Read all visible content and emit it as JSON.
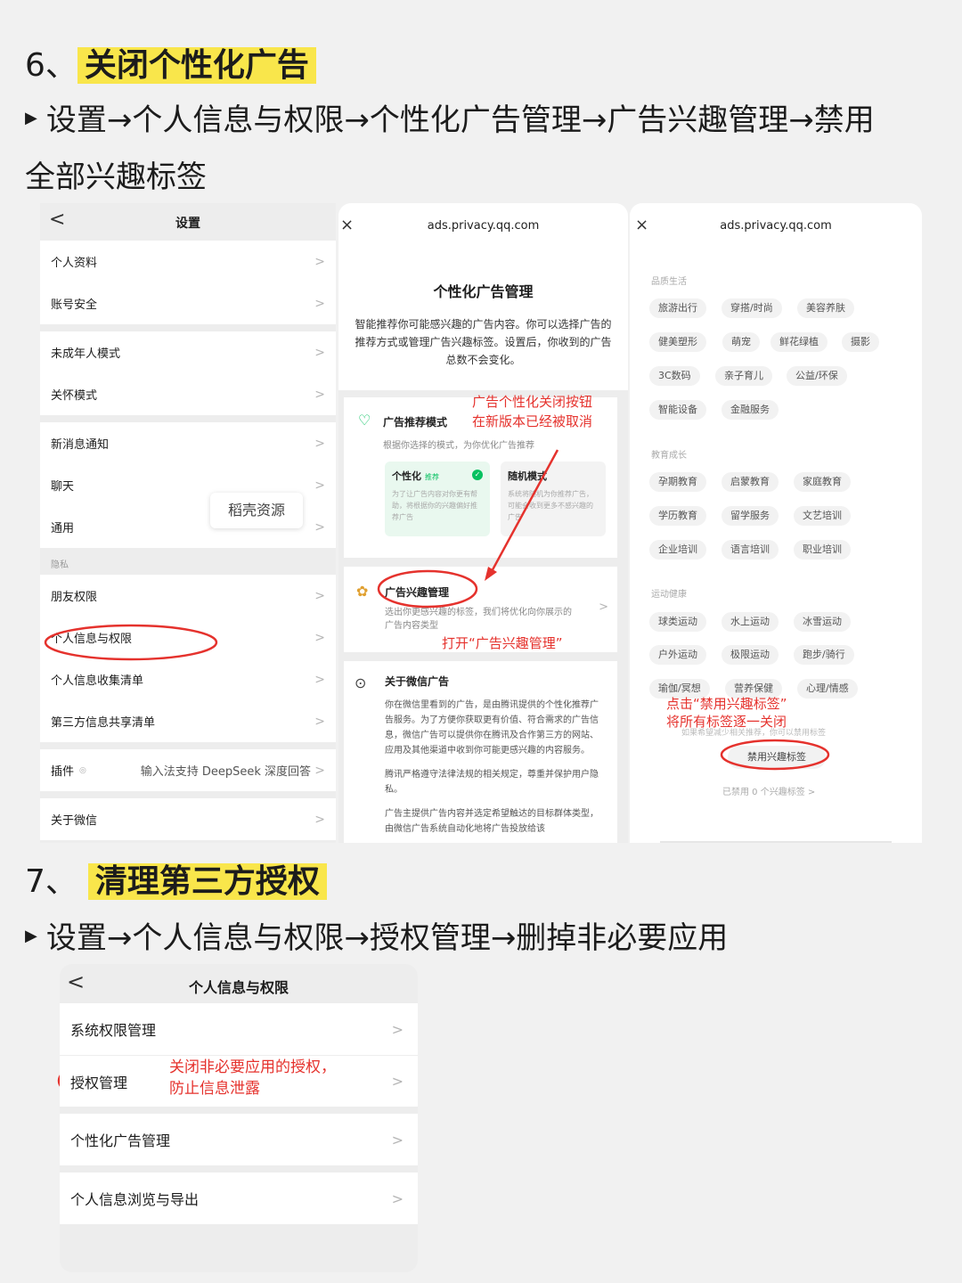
{
  "section6": {
    "num": "6、",
    "title": "关闭个性化广告",
    "path_line1": "设置→个人信息与权限→个性化广告管理→广告兴趣管理→禁用",
    "path_line2": "全部兴趣标签"
  },
  "panel_settings": {
    "back": "<",
    "title": "设置",
    "groups": [
      [
        "个人资料",
        "账号安全"
      ],
      [
        "未成年人模式",
        "关怀模式"
      ],
      [
        "新消息通知",
        "聊天",
        "通用"
      ]
    ],
    "privacy_header": "隐私",
    "privacy_items": [
      "朋友权限",
      "个人信息与权限",
      "个人信息收集清单",
      "第三方信息共享清单"
    ],
    "plugin_label": "插件",
    "plugin_value": "输入法支持 DeepSeek 深度回答",
    "about": "关于微信",
    "chevron": ">",
    "toast": "稻壳资源"
  },
  "panel_ads": {
    "close": "×",
    "url": "ads.privacy.qq.com",
    "heading": "个性化广告管理",
    "desc": "智能推荐你可能感兴趣的广告内容。你可以选择广告的推荐方式或管理广告兴趣标签。设置后，你收到的广告总数不会变化。",
    "rec_title": "广告推荐模式",
    "rec_sub": "根据你选择的模式，为你优化广告推荐",
    "mode_personal": "个性化",
    "mode_badge": "推荐",
    "mode_personal_desc": "为了让广告内容对你更有帮助，将根据你的兴趣偏好推荐广告",
    "mode_random": "随机模式",
    "mode_random_desc": "系统将随机为你推荐广告，可能会收到更多不感兴趣的广告",
    "interest_title": "广告兴趣管理",
    "interest_sub": "选出你更感兴趣的标签，我们将优化向你展示的广告内容类型",
    "about_title": "关于微信广告",
    "about_p1": "你在微信里看到的广告，是由腾讯提供的个性化推荐广告服务。为了方便你获取更有价值、符合需求的广告信息，微信广告可以提供你在腾讯及合作第三方的网站、应用及其他渠道中收到你可能更感兴趣的内容服务。",
    "about_p2": "腾讯严格遵守法律法规的相关规定，尊重并保护用户隐私。",
    "about_p3": "广告主提供广告内容并选定希望触达的目标群体类型，由微信广告系统自动化地将广告投放给该",
    "annot_removed_1": "广告个性化关闭按钮",
    "annot_removed_2": "在新版本已经被取消",
    "annot_open": "打开“广告兴趣管理”"
  },
  "panel_tags": {
    "close": "×",
    "url": "ads.privacy.qq.com",
    "cat1": "品质生活",
    "cat1_tags": [
      [
        "旅游出行",
        "穿搭/时尚",
        "美容养肤"
      ],
      [
        "健美塑形",
        "萌宠",
        "鲜花绿植",
        "摄影"
      ],
      [
        "3C数码",
        "亲子育儿",
        "公益/环保"
      ],
      [
        "智能设备",
        "金融服务"
      ]
    ],
    "cat2": "教育成长",
    "cat2_tags": [
      [
        "孕期教育",
        "启蒙教育",
        "家庭教育"
      ],
      [
        "学历教育",
        "留学服务",
        "文艺培训"
      ],
      [
        "企业培训",
        "语言培训",
        "职业培训"
      ]
    ],
    "cat3": "运动健康",
    "cat3_tags": [
      [
        "球类运动",
        "水上运动",
        "冰雪运动"
      ],
      [
        "户外运动",
        "极限运动",
        "跑步/骑行"
      ],
      [
        "瑜伽/冥想",
        "营养保健",
        "心理/情感"
      ]
    ],
    "hint": "如果希望减少相关推荐，你可以禁用标签",
    "disable_btn": "禁用兴趣标签",
    "disabled_count": "已禁用 0 个兴趣标签 >",
    "annot_1": "点击“禁用兴趣标签”",
    "annot_2": "将所有标签逐一关闭"
  },
  "section7": {
    "num": "7、",
    "title": "清理第三方授权",
    "path_line": "设置→个人信息与权限→授权管理→删掉非必要应用"
  },
  "panel_perm": {
    "back": "<",
    "title": "个人信息与权限",
    "items": [
      "系统权限管理",
      "授权管理",
      "个性化广告管理",
      "个人信息浏览与导出"
    ],
    "chevron": ">",
    "annot_1": "关闭非必要应用的授权，",
    "annot_2": "防止信息泄露"
  },
  "colors": {
    "highlight": "#f9e64b",
    "annotation_red": "#e5322d",
    "wechat_green": "#07c160"
  }
}
